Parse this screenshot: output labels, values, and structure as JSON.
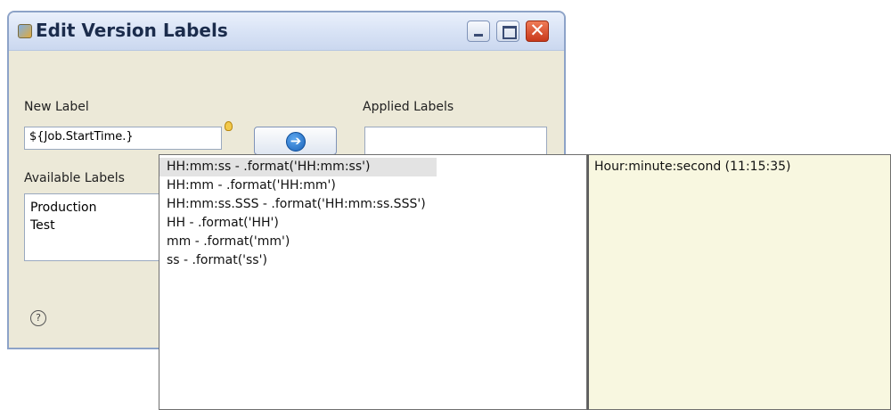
{
  "dialog": {
    "title": "Edit Version Labels",
    "new_label_heading": "New Label",
    "new_label_value": "${Job.StartTime.}",
    "applied_labels_heading": "Applied Labels",
    "available_labels_heading": "Available Labels",
    "available_labels": [
      "Production",
      "Test"
    ],
    "close_glyph": "✕",
    "apply_arrow": "➔",
    "help_glyph": "?"
  },
  "content_assist": {
    "proposals": [
      "HH:mm:ss - .format('HH:mm:ss')",
      "HH:mm - .format('HH:mm')",
      "HH:mm:ss.SSS - .format('HH:mm:ss.SSS')",
      "HH - .format('HH')",
      "mm - .format('mm')",
      "ss - .format('ss')"
    ],
    "selected_index": 0,
    "description": "Hour:minute:second (11:15:35)"
  },
  "colors": {
    "dialog_bg": "#ece9d8",
    "info_bg": "#f8f7e0",
    "selection": "#e3e3e3",
    "close_button": "#c8381b"
  }
}
